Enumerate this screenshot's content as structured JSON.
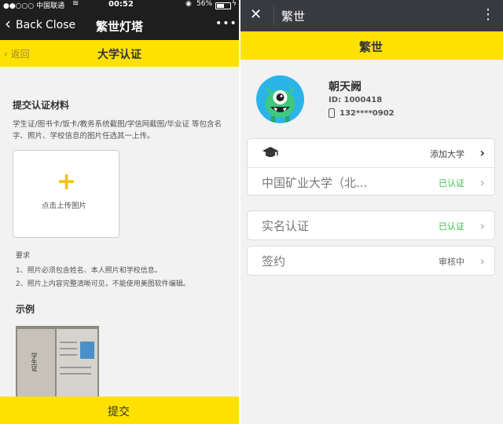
{
  "left": {
    "status_bar": {
      "carrier": "●●○○○ 中国联通",
      "time": "00:52",
      "battery": "56%"
    },
    "nav": {
      "back": "Back",
      "close": "Close",
      "title": "繁世灯塔",
      "more": "•••"
    },
    "header": {
      "back": "返回",
      "title": "大学认证"
    },
    "section_title": "提交认证材料",
    "description": "学生证/图书卡/饭卡/教务系统截图/学信网截图/毕业证 等包含名字、照片、学校信息的图片任选其一上传。",
    "upload": {
      "plus": "+",
      "label": "点击上传图片"
    },
    "requirements": {
      "title": "要求",
      "items": [
        "1、照片必须包含姓名、本人照片和学校信息。",
        "2、照片上内容完整清晰可见，不能使用美图软件编辑。"
      ]
    },
    "example_title": "示例",
    "example_card": {
      "left": "学生证",
      "stamp": "学生证"
    },
    "submit": "提交",
    "colors": {
      "accent": "#ffe100",
      "dark": "#1e1e1e"
    }
  },
  "right": {
    "nav": {
      "close": "✕",
      "title": "繁世",
      "more": "⋮"
    },
    "header_title": "繁世",
    "profile": {
      "name": "朝天阙",
      "id": "ID: 1000418",
      "phone": "132****0902"
    },
    "university_card": {
      "add": "添加大学",
      "school": "中国矿业大学（北...",
      "school_status": "已认证"
    },
    "realname": {
      "label": "实名认证",
      "status": "已认证"
    },
    "contract": {
      "label": "签约",
      "status": "审核中"
    },
    "colors": {
      "header": "#393a3f",
      "accent": "#ffe100",
      "verified": "#3dbb4a",
      "avatar_bg": "#2ab4e8",
      "monster": "#3ec97f"
    }
  }
}
